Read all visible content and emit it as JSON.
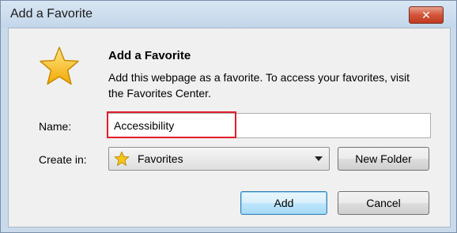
{
  "window": {
    "title": "Add a Favorite",
    "close_glyph": "✕"
  },
  "dialog": {
    "heading": "Add a Favorite",
    "description": "Add this webpage as a favorite. To access your favorites, visit the Favorites Center.",
    "icon": "star-icon"
  },
  "form": {
    "name_label": "Name:",
    "name_value": "Accessibility",
    "create_in_label": "Create in:",
    "create_in_value": "Favorites",
    "create_in_icon": "favorites-star-icon"
  },
  "buttons": {
    "new_folder": "New Folder",
    "add": "Add",
    "cancel": "Cancel"
  },
  "colors": {
    "highlight": "#e11d2a",
    "close_button": "#d2553a",
    "star": "#f5c518"
  }
}
